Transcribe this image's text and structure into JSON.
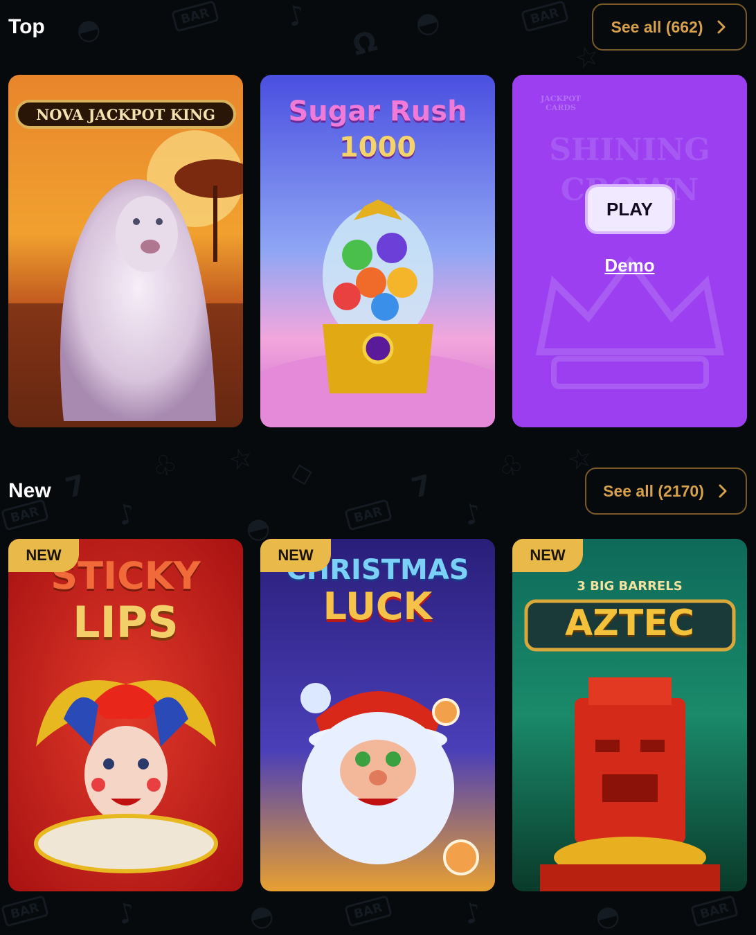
{
  "top_section": {
    "title": "Top",
    "see_all_label": "See all (662)",
    "games": [
      {
        "title": "NOVA JACKPOT KING",
        "icon": "lion-art"
      },
      {
        "title_line1": "Sugar Rush",
        "title_line2": "1000",
        "icon": "gumball-machine-art"
      },
      {
        "title": "SHINING CROWN",
        "studio_text": "JACKPOT CARDS",
        "icon": "crown-art",
        "play_label": "PLAY",
        "demo_label": "Demo"
      }
    ]
  },
  "new_section": {
    "title": "New",
    "see_all_label": "See all (2170)",
    "games": [
      {
        "badge": "NEW",
        "title_line1": "STICKY",
        "title_line2": "LIPS",
        "icon": "jester-art"
      },
      {
        "badge": "NEW",
        "title_line1": "CHRISTMAS",
        "title_line2": "LUCK",
        "icon": "santa-art"
      },
      {
        "badge": "NEW",
        "title_line1": "3 BIG BARRELS",
        "title_line2": "AZTEC",
        "icon": "aztec-idol-art"
      }
    ]
  },
  "colors": {
    "background": "#060a0d",
    "accent_gold": "#d6a14a",
    "badge": "#e9b949",
    "hover_purple": "#9b3ff0"
  }
}
